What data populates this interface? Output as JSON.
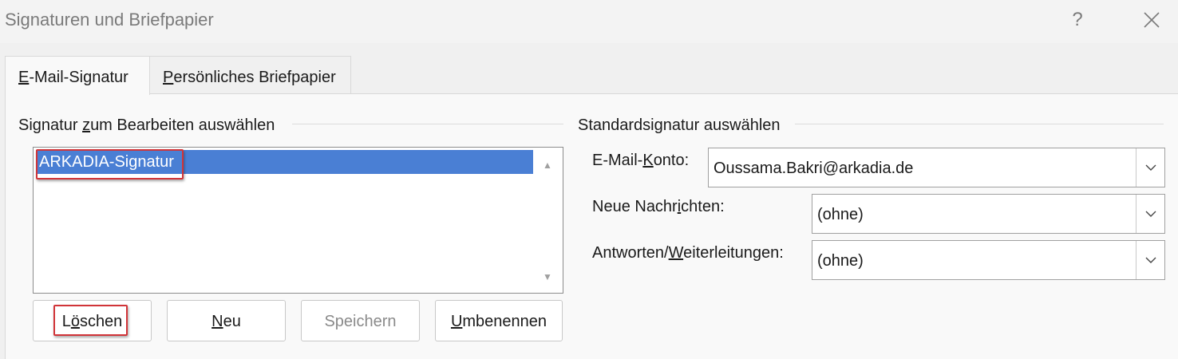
{
  "window": {
    "title": "Signaturen und Briefpapier",
    "help_label": "?"
  },
  "tabs": [
    {
      "label_underlined": "E",
      "label_rest": "-Mail-Signatur",
      "active": true
    },
    {
      "label_underlined": "P",
      "label_rest": "ersönliches Briefpapier",
      "active": false
    }
  ],
  "edit_group": {
    "title_pre": "Signatur ",
    "title_u": "z",
    "title_post": "um Bearbeiten auswählen",
    "signatures": [
      "ARKADIA-Signatur"
    ],
    "selected_index": 0
  },
  "buttons": {
    "delete": {
      "pre": "L",
      "u": "ö",
      "post": "schen"
    },
    "new": {
      "pre": "",
      "u": "N",
      "post": "eu"
    },
    "save": {
      "label": "Speichern",
      "disabled": true
    },
    "rename": {
      "pre": "",
      "u": "U",
      "post": "mbenennen"
    }
  },
  "default_group": {
    "title": "Standardsignatur auswählen",
    "account_label_pre": "E-Mail-",
    "account_label_u": "K",
    "account_label_post": "onto:",
    "account_value": "Oussama.Bakri@arkadia.de",
    "new_msg_label_pre": "Neue Nachr",
    "new_msg_label_u": "i",
    "new_msg_label_post": "chten:",
    "new_msg_value": "(ohne)",
    "reply_label_pre": "Antworten/",
    "reply_label_u": "W",
    "reply_label_post": "eiterleitungen:",
    "reply_value": "(ohne)"
  },
  "colors": {
    "selection": "#4a7fd4",
    "highlight_box": "#d13438"
  }
}
